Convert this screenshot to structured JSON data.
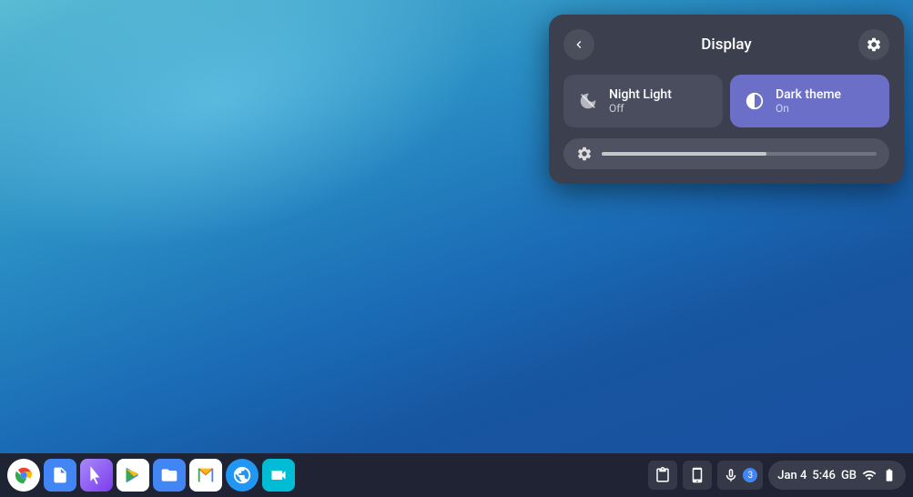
{
  "desktop": {
    "background": "blue gradient"
  },
  "panel": {
    "title": "Display",
    "back_label": "←",
    "settings_label": "⚙",
    "tiles": [
      {
        "id": "night-light",
        "label": "Night Light",
        "sublabel": "Off",
        "icon": "night-light-icon",
        "active": false
      },
      {
        "id": "dark-theme",
        "label": "Dark theme",
        "sublabel": "On",
        "icon": "dark-theme-icon",
        "active": true
      }
    ],
    "brightness": {
      "icon": "gear-icon",
      "value": 60
    }
  },
  "taskbar": {
    "apps": [
      {
        "id": "chrome",
        "label": "Chrome",
        "color": "#fff"
      },
      {
        "id": "docs",
        "label": "Google Docs",
        "color": "#4285F4"
      },
      {
        "id": "cursor",
        "label": "Cursor",
        "color": "#a78bfa"
      },
      {
        "id": "play",
        "label": "Google Play",
        "color": "#fff"
      },
      {
        "id": "files",
        "label": "Files",
        "color": "#4285F4"
      },
      {
        "id": "gmail",
        "label": "Gmail",
        "color": "#fff"
      },
      {
        "id": "safari",
        "label": "Browser",
        "color": "#2196F3"
      },
      {
        "id": "duo",
        "label": "Duo",
        "color": "#00BCD4"
      }
    ],
    "system": {
      "clipboard_icon": "clipboard-icon",
      "phone_icon": "phone-icon",
      "mic_icon": "mic-icon",
      "notification_count": "3",
      "date": "Jan 4",
      "time": "5:46",
      "network_label": "GB",
      "wifi_icon": "wifi-icon",
      "battery_icon": "battery-icon"
    }
  }
}
